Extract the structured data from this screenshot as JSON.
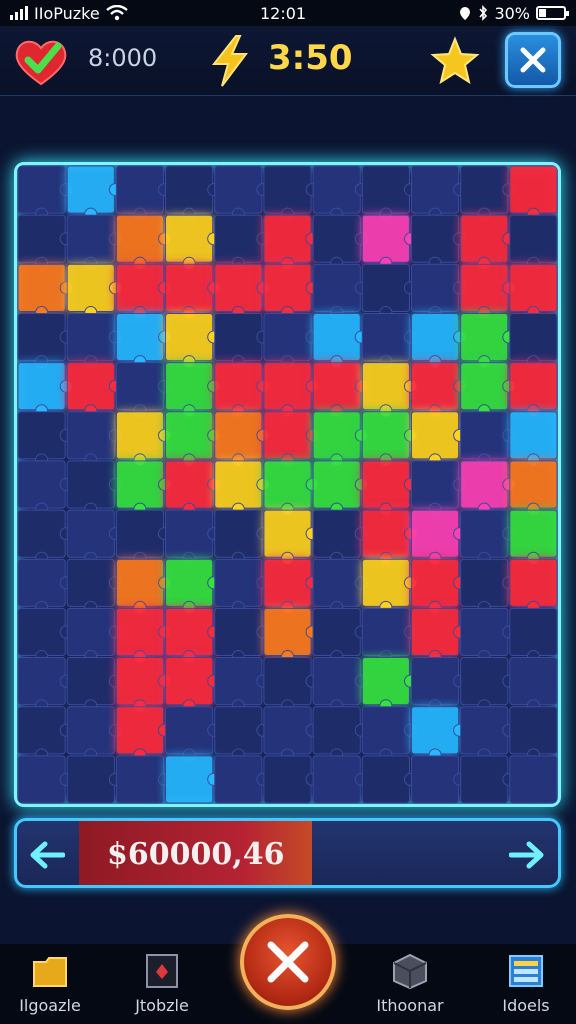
{
  "status_bar": {
    "carrier": "IIoPuzke",
    "time": "12:01",
    "battery": "30%",
    "battery_level": 0.3
  },
  "hud": {
    "score": "8:000",
    "timer": "3:50"
  },
  "progress": {
    "value": "$60000,46",
    "fill_fraction": 0.42
  },
  "tabs": [
    {
      "label": "Ilgoazle",
      "icon": "folder-icon"
    },
    {
      "label": "Jtobzle",
      "icon": "card-icon"
    },
    {
      "label": "Ithoonar",
      "icon": "cube-icon"
    },
    {
      "label": "Idoels",
      "icon": "list-icon"
    }
  ],
  "board": {
    "cols": 11,
    "rows": 13,
    "accent": "#7ff6ff"
  }
}
